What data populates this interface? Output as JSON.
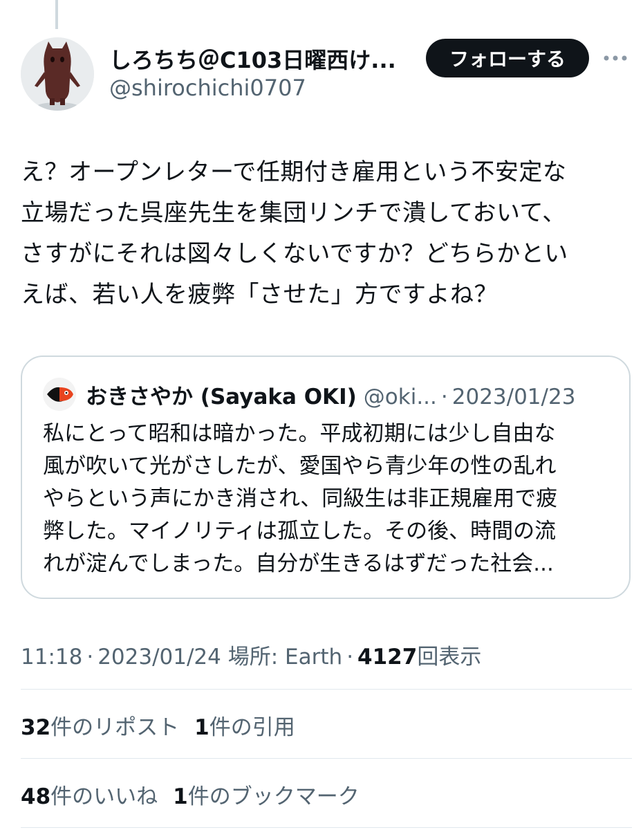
{
  "author": {
    "display_name": "しろちち＠C103日曜西け...",
    "handle": "@shirochichi0707",
    "follow_label": "フォローする"
  },
  "tweet": {
    "text": "え？オープンレターで任期付き雇用という不安定な\n立場だった呉座先生を集団リンチで潰しておいて、\nさすがにそれは図々しくないですか？どちらかとい\nえば、若い人を疲弊「させた」方ですよね？"
  },
  "quote": {
    "display_name": "おきさやか (Sayaka OKI)",
    "handle": "@oki...",
    "separator": "·",
    "date": "2023/01/23",
    "text": "私にとって昭和は暗かった。平成初期には少し自由な\n風が吹いて光がさしたが、愛国やら青少年の性の乱れ\nやらという声にかき消され、同級生は非正規雇用で疲\n弊した。マイノリティは孤立した。その後、時間の流\nれが淀んでしまった。自分が生きるはずだった社会..."
  },
  "meta": {
    "time": "11:18",
    "separator": "·",
    "date": "2023/01/24",
    "location": "場所: Earth",
    "views_count": "4127",
    "views_label": "回表示"
  },
  "stats": {
    "reposts_count": "32",
    "reposts_label": "件のリポスト",
    "quotes_count": "1",
    "quotes_label": "件の引用",
    "likes_count": "48",
    "likes_label": "件のいいね",
    "bookmarks_count": "1",
    "bookmarks_label": "件のブックマーク"
  },
  "colors": {
    "text": "#0f1419",
    "secondary": "#536471",
    "border": "#cfd9de",
    "follow_bg": "#0f1419"
  },
  "icons": [
    "more-icon"
  ]
}
